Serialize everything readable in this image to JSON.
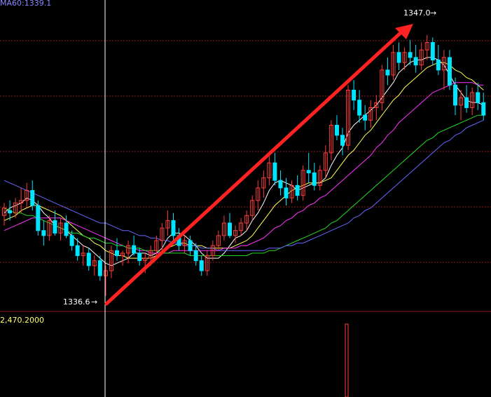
{
  "chart_data": {
    "type": "candlestick",
    "indicator_text": "MA60:1339.1",
    "volume_text": "2,470.2000",
    "annotations": {
      "low_label": "1336.6",
      "high_label": "1347.0",
      "arrow_marker": "→"
    },
    "price_range": [
      1336.2,
      1348.0
    ],
    "colors": {
      "background": "#000000",
      "up_candle": "#ff3b3b",
      "down_candle": "#00e5ff",
      "grid": "#8b1a1a",
      "crosshair": "#ffffff",
      "ma5": "#ffffff",
      "ma10": "#ffff55",
      "ma20": "#ff33ff",
      "ma40": "#22dd22",
      "ma60": "#6666ff",
      "trend_arrow": "#ff2222",
      "volume_text": "#ffff66",
      "indicator_text": "#8888ff"
    },
    "candles": [
      [
        1339.8,
        1340.3,
        1339.4,
        1340.1
      ],
      [
        1340.0,
        1340.4,
        1339.6,
        1339.9
      ],
      [
        1339.9,
        1340.5,
        1339.7,
        1340.3
      ],
      [
        1340.3,
        1340.9,
        1339.9,
        1340.4
      ],
      [
        1340.4,
        1341.1,
        1340.1,
        1340.8
      ],
      [
        1340.8,
        1341.2,
        1340.0,
        1340.2
      ],
      [
        1340.2,
        1340.4,
        1339.0,
        1339.2
      ],
      [
        1339.2,
        1339.6,
        1338.6,
        1339.0
      ],
      [
        1339.0,
        1339.8,
        1338.8,
        1339.6
      ],
      [
        1339.6,
        1340.0,
        1339.0,
        1339.1
      ],
      [
        1339.1,
        1339.7,
        1338.8,
        1339.5
      ],
      [
        1339.5,
        1339.8,
        1338.9,
        1339.0
      ],
      [
        1339.0,
        1339.2,
        1338.4,
        1338.6
      ],
      [
        1338.6,
        1338.9,
        1338.0,
        1338.2
      ],
      [
        1338.2,
        1338.6,
        1337.8,
        1338.3
      ],
      [
        1338.3,
        1338.5,
        1337.6,
        1337.8
      ],
      [
        1337.8,
        1338.2,
        1337.4,
        1338.0
      ],
      [
        1338.0,
        1338.2,
        1337.2,
        1337.4
      ],
      [
        1337.4,
        1337.8,
        1336.6,
        1337.6
      ],
      [
        1337.6,
        1338.6,
        1337.3,
        1338.4
      ],
      [
        1338.4,
        1338.9,
        1338.0,
        1338.2
      ],
      [
        1338.2,
        1338.4,
        1337.8,
        1338.3
      ],
      [
        1338.3,
        1338.8,
        1337.9,
        1338.6
      ],
      [
        1338.6,
        1339.0,
        1338.2,
        1338.3
      ],
      [
        1338.3,
        1338.5,
        1337.8,
        1338.0
      ],
      [
        1338.0,
        1338.3,
        1337.5,
        1338.1
      ],
      [
        1338.1,
        1338.6,
        1337.8,
        1338.4
      ],
      [
        1338.4,
        1339.0,
        1338.1,
        1338.8
      ],
      [
        1338.8,
        1339.5,
        1338.4,
        1339.3
      ],
      [
        1339.3,
        1340.0,
        1339.0,
        1339.6
      ],
      [
        1339.6,
        1339.9,
        1338.8,
        1339.0
      ],
      [
        1339.0,
        1339.3,
        1338.4,
        1338.6
      ],
      [
        1338.6,
        1339.0,
        1338.3,
        1338.8
      ],
      [
        1338.8,
        1339.0,
        1338.2,
        1338.4
      ],
      [
        1338.4,
        1338.7,
        1337.8,
        1338.0
      ],
      [
        1338.0,
        1338.2,
        1337.4,
        1337.6
      ],
      [
        1337.6,
        1338.4,
        1337.4,
        1338.2
      ],
      [
        1338.2,
        1338.8,
        1338.0,
        1338.6
      ],
      [
        1338.6,
        1339.2,
        1338.4,
        1339.0
      ],
      [
        1339.0,
        1339.8,
        1338.8,
        1339.5
      ],
      [
        1339.5,
        1339.9,
        1338.9,
        1339.0
      ],
      [
        1339.0,
        1339.4,
        1338.7,
        1339.2
      ],
      [
        1339.2,
        1339.7,
        1339.0,
        1339.5
      ],
      [
        1339.5,
        1340.0,
        1339.2,
        1339.8
      ],
      [
        1339.8,
        1340.6,
        1339.6,
        1340.4
      ],
      [
        1340.4,
        1341.2,
        1340.0,
        1340.9
      ],
      [
        1340.9,
        1341.6,
        1340.5,
        1341.3
      ],
      [
        1341.3,
        1342.2,
        1341.0,
        1341.9
      ],
      [
        1341.9,
        1342.3,
        1341.0,
        1341.2
      ],
      [
        1341.2,
        1341.6,
        1340.6,
        1340.9
      ],
      [
        1340.9,
        1341.3,
        1340.2,
        1340.5
      ],
      [
        1340.5,
        1341.2,
        1340.3,
        1341.0
      ],
      [
        1341.0,
        1341.4,
        1340.4,
        1340.6
      ],
      [
        1340.6,
        1341.8,
        1340.4,
        1341.6
      ],
      [
        1341.6,
        1342.3,
        1341.1,
        1341.5
      ],
      [
        1341.5,
        1341.9,
        1340.8,
        1341.0
      ],
      [
        1341.0,
        1341.8,
        1340.8,
        1341.6
      ],
      [
        1341.6,
        1342.6,
        1341.3,
        1342.3
      ],
      [
        1342.3,
        1343.6,
        1342.0,
        1343.4
      ],
      [
        1343.4,
        1343.8,
        1342.8,
        1343.0
      ],
      [
        1343.0,
        1343.3,
        1342.2,
        1342.6
      ],
      [
        1342.6,
        1345.0,
        1342.4,
        1344.8
      ],
      [
        1344.8,
        1345.2,
        1344.0,
        1344.4
      ],
      [
        1344.4,
        1344.8,
        1343.5,
        1343.8
      ],
      [
        1343.8,
        1344.2,
        1343.2,
        1343.6
      ],
      [
        1343.6,
        1344.4,
        1343.3,
        1344.1
      ],
      [
        1344.1,
        1344.6,
        1343.6,
        1344.3
      ],
      [
        1344.3,
        1345.8,
        1344.0,
        1345.6
      ],
      [
        1345.6,
        1346.1,
        1345.0,
        1345.4
      ],
      [
        1345.4,
        1346.6,
        1345.2,
        1346.3
      ],
      [
        1346.3,
        1346.7,
        1345.6,
        1345.9
      ],
      [
        1345.9,
        1346.5,
        1345.6,
        1346.3
      ],
      [
        1346.3,
        1346.8,
        1345.8,
        1346.1
      ],
      [
        1346.1,
        1346.6,
        1345.5,
        1345.8
      ],
      [
        1345.8,
        1346.7,
        1345.6,
        1346.4
      ],
      [
        1346.4,
        1347.0,
        1346.0,
        1346.7
      ],
      [
        1346.7,
        1346.9,
        1345.8,
        1346.0
      ],
      [
        1346.0,
        1346.6,
        1345.4,
        1345.6
      ],
      [
        1345.6,
        1346.4,
        1344.8,
        1346.1
      ],
      [
        1346.1,
        1346.4,
        1344.8,
        1345.0
      ],
      [
        1345.0,
        1345.3,
        1343.8,
        1344.2
      ],
      [
        1344.2,
        1344.8,
        1343.6,
        1344.5
      ],
      [
        1344.5,
        1345.0,
        1343.9,
        1344.1
      ],
      [
        1344.1,
        1344.9,
        1343.8,
        1344.7
      ],
      [
        1344.7,
        1345.1,
        1344.0,
        1344.3
      ],
      [
        1344.3,
        1344.7,
        1343.6,
        1343.8
      ]
    ],
    "ma_lines": [
      {
        "values": [
          1339.9,
          1340.1,
          1340.2,
          1340.3,
          1340.5,
          1340.4,
          1340.2,
          1339.9,
          1339.7,
          1339.4,
          1339.3,
          1339.2,
          1339.0,
          1338.8,
          1338.6,
          1338.5,
          1338.3,
          1338.1,
          1337.9,
          1337.8,
          1337.9,
          1338.0,
          1338.1,
          1338.3,
          1338.3,
          1338.3,
          1338.2,
          1338.3,
          1338.5,
          1338.9,
          1339.1,
          1339.1,
          1339.0,
          1338.8,
          1338.6,
          1338.3,
          1338.1,
          1338.1,
          1338.1,
          1338.3,
          1338.6,
          1338.9,
          1339.0,
          1339.2,
          1339.6,
          1339.9,
          1340.3,
          1340.8,
          1341.1,
          1341.2,
          1341.1,
          1341.0,
          1340.8,
          1340.9,
          1341.0,
          1341.1,
          1341.1,
          1341.3,
          1341.8,
          1342.2,
          1342.5,
          1343.1,
          1343.4,
          1343.6,
          1343.8,
          1344.0,
          1344.2,
          1344.5,
          1344.8,
          1345.1,
          1345.5,
          1345.7,
          1345.9,
          1346.0,
          1346.0,
          1346.1,
          1346.1,
          1346.0,
          1345.8,
          1345.4,
          1345.0,
          1344.7,
          1344.4,
          1344.3,
          1344.3,
          1344.2
        ]
      },
      {
        "values": [
          1339.6,
          1339.7,
          1339.8,
          1340.0,
          1340.1,
          1340.2,
          1340.2,
          1340.1,
          1340.0,
          1339.9,
          1339.8,
          1339.6,
          1339.4,
          1339.2,
          1339.0,
          1338.9,
          1338.7,
          1338.6,
          1338.4,
          1338.3,
          1338.2,
          1338.2,
          1338.1,
          1338.1,
          1338.1,
          1338.1,
          1338.1,
          1338.2,
          1338.3,
          1338.5,
          1338.6,
          1338.7,
          1338.7,
          1338.6,
          1338.6,
          1338.6,
          1338.5,
          1338.5,
          1338.5,
          1338.5,
          1338.5,
          1338.6,
          1338.7,
          1338.8,
          1339.0,
          1339.3,
          1339.6,
          1339.9,
          1340.2,
          1340.4,
          1340.6,
          1340.8,
          1340.9,
          1341.0,
          1341.1,
          1341.1,
          1341.1,
          1341.2,
          1341.3,
          1341.6,
          1341.9,
          1342.2,
          1342.4,
          1342.7,
          1343.0,
          1343.2,
          1343.5,
          1343.8,
          1344.1,
          1344.4,
          1344.6,
          1344.9,
          1345.1,
          1345.3,
          1345.5,
          1345.7,
          1345.8,
          1345.9,
          1345.9,
          1345.8,
          1345.6,
          1345.5,
          1345.3,
          1345.2,
          1345.0,
          1344.8
        ]
      },
      {
        "values": [
          1339.2,
          1339.3,
          1339.4,
          1339.5,
          1339.6,
          1339.7,
          1339.7,
          1339.7,
          1339.7,
          1339.7,
          1339.7,
          1339.6,
          1339.5,
          1339.4,
          1339.3,
          1339.2,
          1339.1,
          1339.0,
          1338.9,
          1338.8,
          1338.7,
          1338.6,
          1338.5,
          1338.5,
          1338.4,
          1338.4,
          1338.3,
          1338.3,
          1338.3,
          1338.3,
          1338.4,
          1338.4,
          1338.4,
          1338.4,
          1338.4,
          1338.4,
          1338.4,
          1338.4,
          1338.4,
          1338.5,
          1338.5,
          1338.5,
          1338.6,
          1338.6,
          1338.7,
          1338.8,
          1338.9,
          1339.1,
          1339.3,
          1339.4,
          1339.6,
          1339.7,
          1339.9,
          1340.0,
          1340.2,
          1340.3,
          1340.5,
          1340.6,
          1340.8,
          1341.0,
          1341.2,
          1341.4,
          1341.6,
          1341.8,
          1342.0,
          1342.2,
          1342.5,
          1342.7,
          1343.0,
          1343.2,
          1343.5,
          1343.7,
          1343.9,
          1344.1,
          1344.3,
          1344.5,
          1344.7,
          1344.8,
          1344.9,
          1345.0,
          1345.1,
          1345.1,
          1345.1,
          1345.1,
          1345.0,
          1345.0
        ]
      },
      {
        "values": [
          1340.1,
          1340.0,
          1339.9,
          1339.9,
          1339.8,
          1339.8,
          1339.7,
          1339.6,
          1339.5,
          1339.4,
          1339.3,
          1339.2,
          1339.1,
          1339.1,
          1339.0,
          1338.9,
          1338.9,
          1338.8,
          1338.7,
          1338.7,
          1338.6,
          1338.6,
          1338.5,
          1338.5,
          1338.5,
          1338.4,
          1338.4,
          1338.4,
          1338.3,
          1338.3,
          1338.3,
          1338.3,
          1338.3,
          1338.2,
          1338.2,
          1338.2,
          1338.2,
          1338.2,
          1338.2,
          1338.2,
          1338.2,
          1338.2,
          1338.2,
          1338.2,
          1338.3,
          1338.3,
          1338.3,
          1338.4,
          1338.4,
          1338.5,
          1338.6,
          1338.7,
          1338.8,
          1338.9,
          1339.0,
          1339.1,
          1339.2,
          1339.3,
          1339.5,
          1339.6,
          1339.8,
          1340.0,
          1340.2,
          1340.4,
          1340.6,
          1340.8,
          1341.0,
          1341.2,
          1341.4,
          1341.6,
          1341.8,
          1342.0,
          1342.2,
          1342.4,
          1342.6,
          1342.8,
          1342.9,
          1343.1,
          1343.2,
          1343.3,
          1343.4,
          1343.5,
          1343.6,
          1343.7,
          1343.8,
          1343.8
        ]
      },
      {
        "values": [
          1341.2,
          1341.1,
          1341.0,
          1340.9,
          1340.8,
          1340.7,
          1340.6,
          1340.5,
          1340.4,
          1340.3,
          1340.2,
          1340.1,
          1340.0,
          1339.9,
          1339.8,
          1339.7,
          1339.6,
          1339.5,
          1339.5,
          1339.4,
          1339.3,
          1339.2,
          1339.2,
          1339.1,
          1339.0,
          1339.0,
          1338.9,
          1338.9,
          1338.8,
          1338.8,
          1338.7,
          1338.7,
          1338.6,
          1338.6,
          1338.6,
          1338.5,
          1338.5,
          1338.5,
          1338.4,
          1338.4,
          1338.4,
          1338.4,
          1338.4,
          1338.4,
          1338.4,
          1338.4,
          1338.4,
          1338.5,
          1338.5,
          1338.5,
          1338.6,
          1338.6,
          1338.7,
          1338.7,
          1338.8,
          1338.9,
          1339.0,
          1339.1,
          1339.2,
          1339.3,
          1339.4,
          1339.5,
          1339.7,
          1339.8,
          1340.0,
          1340.1,
          1340.3,
          1340.5,
          1340.7,
          1340.9,
          1341.1,
          1341.3,
          1341.5,
          1341.7,
          1341.9,
          1342.1,
          1342.3,
          1342.5,
          1342.7,
          1342.8,
          1343.0,
          1343.1,
          1343.3,
          1343.4,
          1343.5,
          1343.6
        ]
      }
    ]
  }
}
